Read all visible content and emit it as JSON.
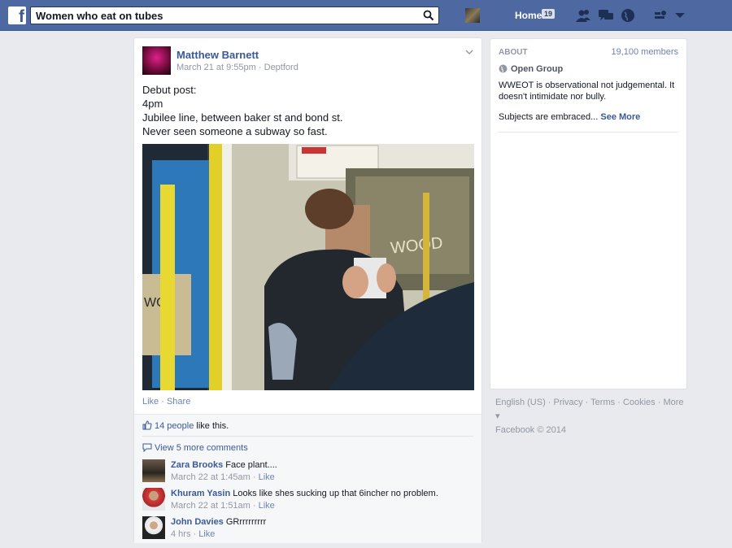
{
  "header": {
    "search_value": "Women who eat on tubes",
    "home_label": "Home",
    "home_count": "19"
  },
  "post": {
    "author": "Matthew Barnett",
    "timestamp": "March 21 at 9:55pm",
    "location": "Deptford",
    "text_lines": [
      "Debut post:",
      "4pm",
      "Jubilee line, between baker st and bond st.",
      "Never seen someone a subway so fast."
    ],
    "like_label": "Like",
    "share_label": "Share",
    "photo_text": "WOOD",
    "likes_count": "14 people",
    "likes_suffix": "like this.",
    "view_more": "View 5 more comments",
    "comments": [
      {
        "name": "Zara Brooks",
        "text": "Face plant....",
        "time": "March 22 at 1:45am",
        "like": "Like"
      },
      {
        "name": "Khuram Yasin",
        "text": "Looks like shes sucking up that 6incher no problem.",
        "time": "March 22 at 1:51am",
        "like": "Like"
      },
      {
        "name": "John Davies",
        "text": "GRrrrrrrrrr",
        "time": "4 hrs",
        "like": "Like"
      }
    ]
  },
  "about": {
    "heading": "ABOUT",
    "members": "19,100 members",
    "group_type": "Open Group",
    "description": "WWEOT is observational not judgemental. It doesn't intimidate nor bully.",
    "description2": "Subjects are embraced...",
    "see_more": "See More"
  },
  "footer": {
    "links": [
      "English (US)",
      "Privacy",
      "Terms",
      "Cookies",
      "More"
    ],
    "copyright": "Facebook © 2014"
  },
  "colors": {
    "brand": "#4e69a2",
    "link": "#3b5998",
    "background": "#e9eaed"
  }
}
